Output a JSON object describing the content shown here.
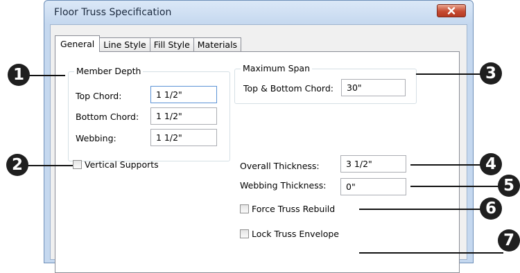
{
  "window": {
    "title": "Floor Truss Specification"
  },
  "tabs": [
    {
      "label": "General",
      "active": true
    },
    {
      "label": "Line Style",
      "active": false
    },
    {
      "label": "Fill Style",
      "active": false
    },
    {
      "label": "Materials",
      "active": false
    }
  ],
  "member_depth": {
    "legend": "Member Depth",
    "top_chord_label": "Top Chord:",
    "top_chord_value": "1 1/2\"",
    "bottom_chord_label": "Bottom Chord:",
    "bottom_chord_value": "1 1/2\"",
    "webbing_label": "Webbing:",
    "webbing_value": "1 1/2\""
  },
  "maximum_span": {
    "legend": "Maximum Span",
    "top_bottom_label": "Top & Bottom Chord:",
    "top_bottom_value": "30\""
  },
  "vertical_supports": {
    "label": "Vertical Supports",
    "checked": false
  },
  "overall_thickness": {
    "label": "Overall Thickness:",
    "value": "3 1/2\""
  },
  "webbing_thickness": {
    "label": "Webbing Thickness:",
    "value": "0\""
  },
  "force_truss_rebuild": {
    "label": "Force Truss Rebuild",
    "checked": false
  },
  "lock_truss_envelope": {
    "label": "Lock Truss Envelope",
    "checked": false
  },
  "callouts": [
    "1",
    "2",
    "3",
    "4",
    "5",
    "6",
    "7"
  ]
}
